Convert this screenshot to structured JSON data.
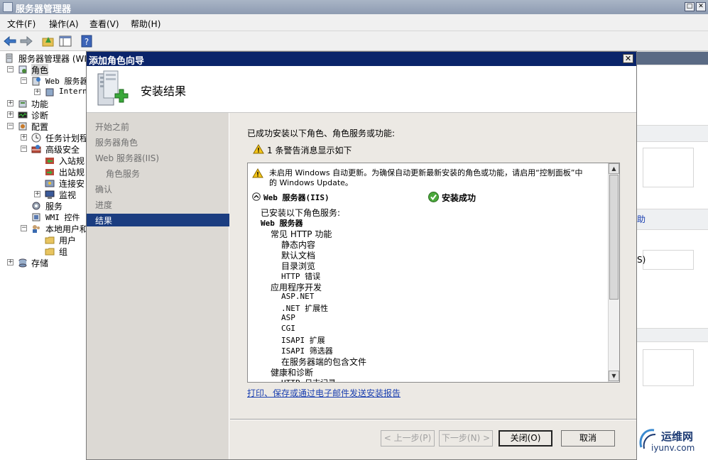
{
  "window": {
    "title": "服务器管理器"
  },
  "menu": {
    "items": [
      "文件(F)",
      "操作(A)",
      "查看(V)",
      "帮助(H)"
    ]
  },
  "tree": {
    "root": "服务器管理器 (WI",
    "roles": "角色",
    "web_server": "Web 服务器",
    "iis": "Intern",
    "features": "功能",
    "diagnostics": "诊断",
    "configuration": "配置",
    "task_scheduler": "任务计划程",
    "advanced_security": "高级安全",
    "inbound": "入站规",
    "outbound": "出站规",
    "connection": "连接安",
    "monitor": "监视",
    "services": "服务",
    "wmi": "WMI 控件",
    "local_users": "本地用户和",
    "users": "用户",
    "groups": "组",
    "storage": "存储"
  },
  "right_panel": {
    "help_fragment": "助",
    "iis_fragment": "S)"
  },
  "dialog": {
    "title": "添加角色向导",
    "close_glyph": "✕",
    "heading": "安装结果",
    "steps": [
      "开始之前",
      "服务器角色",
      "Web 服务器(IIS)",
      "角色服务",
      "确认",
      "进度",
      "结果"
    ],
    "summary": "已成功安装以下角色、角色服务或功能:",
    "warning_count": "1 条警告消息显示如下",
    "result": {
      "warning_text_1": "未启用 Windows 自动更新。为确保自动更新最新安装的角色或功能，请启用“控制面板”中",
      "warning_text_2": "的 Windows Update。",
      "role_name": "Web 服务器(IIS)",
      "status": "安装成功",
      "installed_header": "已安装以下角色服务:",
      "role_bold": "Web 服务器",
      "items": [
        {
          "text": "常见 HTTP 功能",
          "level": 1
        },
        {
          "text": "静态内容",
          "level": 2
        },
        {
          "text": "默认文档",
          "level": 2
        },
        {
          "text": "目录浏览",
          "level": 2
        },
        {
          "text": "HTTP 错误",
          "level": 2
        },
        {
          "text": "应用程序开发",
          "level": 1
        },
        {
          "text": "ASP.NET",
          "level": 2
        },
        {
          "text": ".NET 扩展性",
          "level": 2
        },
        {
          "text": "ASP",
          "level": 2
        },
        {
          "text": "CGI",
          "level": 2
        },
        {
          "text": "ISAPI 扩展",
          "level": 2
        },
        {
          "text": "ISAPI 筛选器",
          "level": 2
        },
        {
          "text": "在服务器端的包含文件",
          "level": 2
        },
        {
          "text": "健康和诊断",
          "level": 1
        },
        {
          "text": "HTTP 日志记录",
          "level": 2
        }
      ]
    },
    "report_link": "打印、保存或通过电子邮件发送安装报告",
    "buttons": {
      "prev": "< 上一步(P)",
      "next": "下一步(N) >",
      "close": "关闭(O)",
      "cancel": "取消"
    }
  },
  "watermark": {
    "name": "运维网",
    "url": "iyunv.com"
  }
}
